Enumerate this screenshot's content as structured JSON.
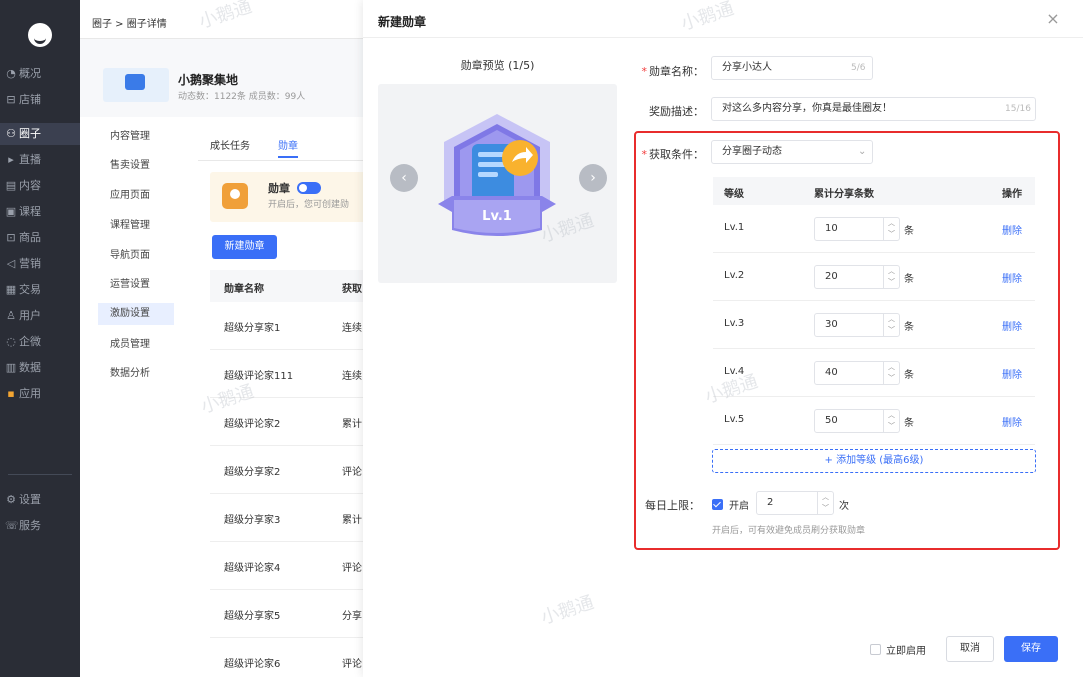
{
  "nav": {
    "items": [
      {
        "icon": "gauge-icon",
        "glyph": "◔",
        "label": "概况"
      },
      {
        "icon": "store-icon",
        "glyph": "⊟",
        "label": "店铺"
      },
      {
        "icon": "group-icon",
        "glyph": "⚇",
        "label": "圈子"
      },
      {
        "icon": "live-icon",
        "glyph": "▸",
        "label": "直播"
      },
      {
        "icon": "content-icon",
        "glyph": "▤",
        "label": "内容"
      },
      {
        "icon": "course-icon",
        "glyph": "▣",
        "label": "课程"
      },
      {
        "icon": "goods-icon",
        "glyph": "⊡",
        "label": "商品"
      },
      {
        "icon": "marketing-icon",
        "glyph": "◁",
        "label": "营销"
      },
      {
        "icon": "trade-icon",
        "glyph": "▦",
        "label": "交易"
      },
      {
        "icon": "user-icon",
        "glyph": "♙",
        "label": "用户"
      },
      {
        "icon": "wecom-icon",
        "glyph": "◌",
        "label": "企微"
      },
      {
        "icon": "data-icon",
        "glyph": "▥",
        "label": "数据"
      },
      {
        "icon": "apps-icon",
        "glyph": "▪",
        "label": "应用"
      },
      {
        "icon": "settings-icon",
        "glyph": "⚙",
        "label": "设置"
      },
      {
        "icon": "service-icon",
        "glyph": "☏",
        "label": "服务"
      }
    ]
  },
  "breadcrumb": "圈子 > 圈子详情",
  "group": {
    "title": "小鹅聚集地",
    "stats": "动态数：1122条  成员数：99人"
  },
  "subnav": [
    "内容管理",
    "售卖设置",
    "应用页面",
    "课程管理",
    "导航页面",
    "运营设置",
    "激励设置",
    "成员管理",
    "数据分析"
  ],
  "tabs": [
    "成长任务",
    "勋章"
  ],
  "banner": {
    "title": "勋章",
    "desc": "开启后，您可创建勋"
  },
  "new_medal_btn": "新建勋章",
  "table": {
    "headers": [
      "勋章名称",
      "获取"
    ],
    "rows": [
      {
        "name": "超级分享家1",
        "cond": "连续"
      },
      {
        "name": "超级评论家111",
        "cond": "连续"
      },
      {
        "name": "超级评论家2",
        "cond": "累计"
      },
      {
        "name": "超级分享家2",
        "cond": "评论"
      },
      {
        "name": "超级分享家3",
        "cond": "累计"
      },
      {
        "name": "超级评论家4",
        "cond": "评论"
      },
      {
        "name": "超级分享家5",
        "cond": "分享"
      },
      {
        "name": "超级评论家6",
        "cond": "评论"
      }
    ]
  },
  "modal": {
    "title": "新建勋章",
    "preview_title": "勋章预览 (1/5)",
    "badge_level": "Lv.1",
    "name_label": "勋章名称：",
    "name_value": "分享小达人",
    "name_count": "5/6",
    "desc_label": "奖励描述：",
    "desc_value": "对这么多内容分享，你真是最佳圈友！",
    "desc_count": "15/16",
    "cond_label": "获取条件：",
    "cond_value": "分享圈子动态",
    "level_headers": [
      "等级",
      "累计分享条数",
      "操作"
    ],
    "levels": [
      {
        "name": "Lv.1",
        "value": "10",
        "unit": "条",
        "action": "删除"
      },
      {
        "name": "Lv.2",
        "value": "20",
        "unit": "条",
        "action": "删除"
      },
      {
        "name": "Lv.3",
        "value": "30",
        "unit": "条",
        "action": "删除"
      },
      {
        "name": "Lv.4",
        "value": "40",
        "unit": "条",
        "action": "删除"
      },
      {
        "name": "Lv.5",
        "value": "50",
        "unit": "条",
        "action": "删除"
      }
    ],
    "add_level": "+ 添加等级 (最高6级)",
    "daily_label": "每日上限：",
    "daily_open": "开启",
    "daily_value": "2",
    "daily_unit": "次",
    "daily_hint": "开启后，可有效避免成员刷分获取勋章",
    "enable_now": "立即启用",
    "cancel": "取消",
    "save": "保存"
  },
  "watermark": "小鹅通",
  "colors": {
    "primary": "#3a6ff7",
    "highlight_box": "#e82c2c",
    "nav_bg": "#2a2d36"
  }
}
